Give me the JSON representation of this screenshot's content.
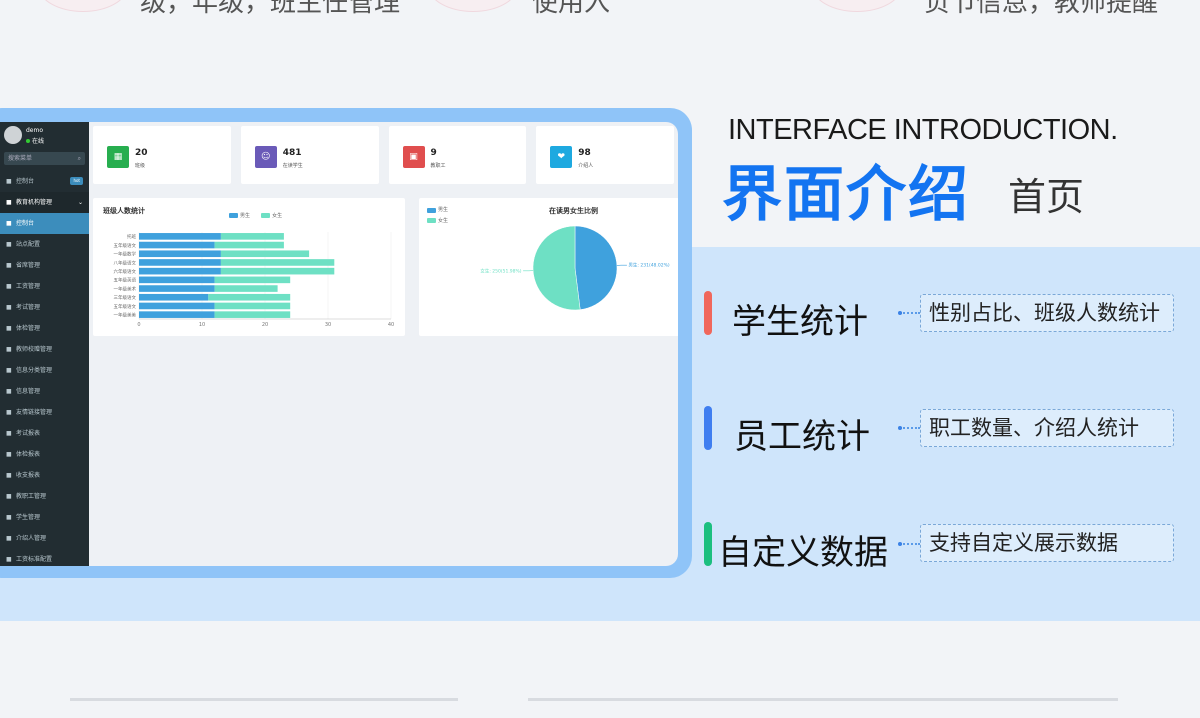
{
  "top_strip": {
    "texts": [
      "级，年级，班主任管理",
      "使用入",
      "负节信息，教师提醒"
    ]
  },
  "app": {
    "sidebar": {
      "user_name": "demo",
      "status": "在线",
      "search_placeholder": "搜索菜单",
      "items": [
        {
          "label": "控制台",
          "icon": "dashboard-icon",
          "badge": "hot",
          "style": "normal"
        },
        {
          "label": "教育机构管理",
          "icon": "bookmark-icon",
          "style": "head"
        },
        {
          "label": "控制台",
          "icon": "monitor-icon",
          "style": "active"
        },
        {
          "label": "站点配置",
          "icon": "gear-icon",
          "style": "normal"
        },
        {
          "label": "省席管理",
          "icon": "dollar-icon",
          "style": "normal"
        },
        {
          "label": "工资管理",
          "icon": "file-icon",
          "style": "normal"
        },
        {
          "label": "考试管理",
          "icon": "exam-icon",
          "style": "normal"
        },
        {
          "label": "体检管理",
          "icon": "clipboard-icon",
          "style": "normal"
        },
        {
          "label": "教师校赠管理",
          "icon": "book-icon",
          "style": "normal"
        },
        {
          "label": "信息分类管理",
          "icon": "tag-icon",
          "style": "normal"
        },
        {
          "label": "信息管理",
          "icon": "list-icon",
          "style": "normal"
        },
        {
          "label": "友情链接管理",
          "icon": "link-icon",
          "style": "normal"
        },
        {
          "label": "考试报表",
          "icon": "table-icon",
          "style": "normal"
        },
        {
          "label": "体检报表",
          "icon": "bar-chart-icon",
          "style": "normal"
        },
        {
          "label": "收支报表",
          "icon": "yen-icon",
          "style": "normal"
        },
        {
          "label": "教职工管理",
          "icon": "user-icon",
          "style": "normal"
        },
        {
          "label": "学生管理",
          "icon": "student-icon",
          "style": "normal"
        },
        {
          "label": "介绍人管理",
          "icon": "referrer-icon",
          "style": "normal"
        },
        {
          "label": "工资标准配置",
          "icon": "settings-icon",
          "style": "normal"
        }
      ]
    },
    "stats": [
      {
        "value": "20",
        "label": "班级",
        "color": "#27ae4f",
        "icon": "grid-icon"
      },
      {
        "value": "481",
        "label": "在读学生",
        "color": "#6a5ab8",
        "icon": "users-icon"
      },
      {
        "value": "9",
        "label": "教职工",
        "color": "#e04e4e",
        "icon": "id-card-icon"
      },
      {
        "value": "98",
        "label": "介绍人",
        "color": "#1ea9e0",
        "icon": "handshake-icon"
      }
    ]
  },
  "chart_data": [
    {
      "type": "bar",
      "orientation": "horizontal",
      "stacked": true,
      "title": "班级人数统计",
      "categories": [
        "托班",
        "五年级语文",
        "一年级数学",
        "八年级语文",
        "六年级语文",
        "五年级英语",
        "一年级美术",
        "三年级语文",
        "五年级语文",
        "一年级美美"
      ],
      "series": [
        {
          "name": "男生",
          "color": "#3fa1dd",
          "values": [
            13,
            12,
            13,
            13,
            13,
            12,
            12,
            11,
            12,
            12
          ]
        },
        {
          "name": "女生",
          "color": "#6ee0c4",
          "values": [
            10,
            11,
            14,
            18,
            18,
            12,
            10,
            13,
            12,
            12
          ]
        }
      ],
      "xticks": [
        0,
        10,
        20,
        30,
        40
      ],
      "xlim": [
        0,
        40
      ]
    },
    {
      "type": "pie",
      "title": "在读男女生比例",
      "legend_position": "top-left",
      "slices": [
        {
          "name": "男生",
          "value": 231,
          "label": "男生: 231(48.02%)",
          "color": "#3fa1dd"
        },
        {
          "name": "女生",
          "value": 250,
          "label": "女生: 250(51.98%)",
          "color": "#6ee0c4"
        }
      ]
    }
  ],
  "heading": {
    "en": "INTERFACE INTRODUCTION.",
    "cn": "界面介绍",
    "sub": "首页"
  },
  "features": [
    {
      "title": "学生统计",
      "desc": "性别占比、班级人数统计",
      "color": "#f0675c"
    },
    {
      "title": "员工统计",
      "desc": "职工数量、介绍人统计",
      "color": "#3f7ef0"
    },
    {
      "title": "自定义数据",
      "desc": "支持自定义展示数据",
      "color": "#1bbf7f"
    }
  ]
}
